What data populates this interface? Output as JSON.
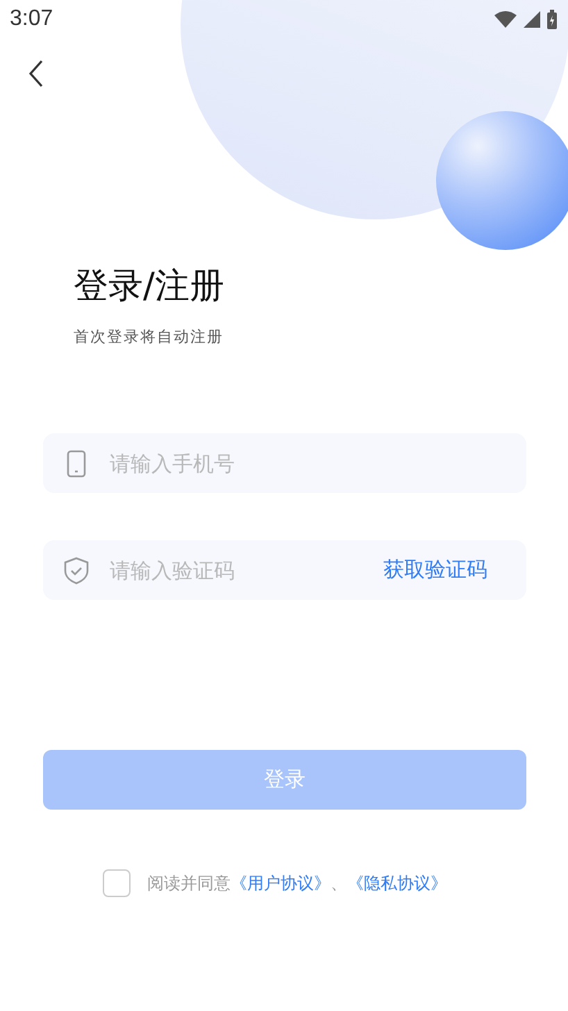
{
  "status_bar": {
    "time": "3:07"
  },
  "title": "登录/注册",
  "subtitle": "首次登录将自动注册",
  "fields": [
    {
      "kind": "phone",
      "placeholder": "请输入手机号"
    },
    {
      "kind": "code",
      "placeholder": "请输入验证码",
      "action": "获取验证码"
    }
  ],
  "login_button": {
    "label": "登录",
    "disabled": true
  },
  "agreement": {
    "checked": false,
    "parts": [
      {
        "kind": "text",
        "text": "阅读并同意"
      },
      {
        "kind": "link",
        "text": "《用户协议》"
      },
      {
        "kind": "text",
        "text": "、"
      },
      {
        "kind": "link",
        "text": "《隐私协议》"
      }
    ]
  }
}
